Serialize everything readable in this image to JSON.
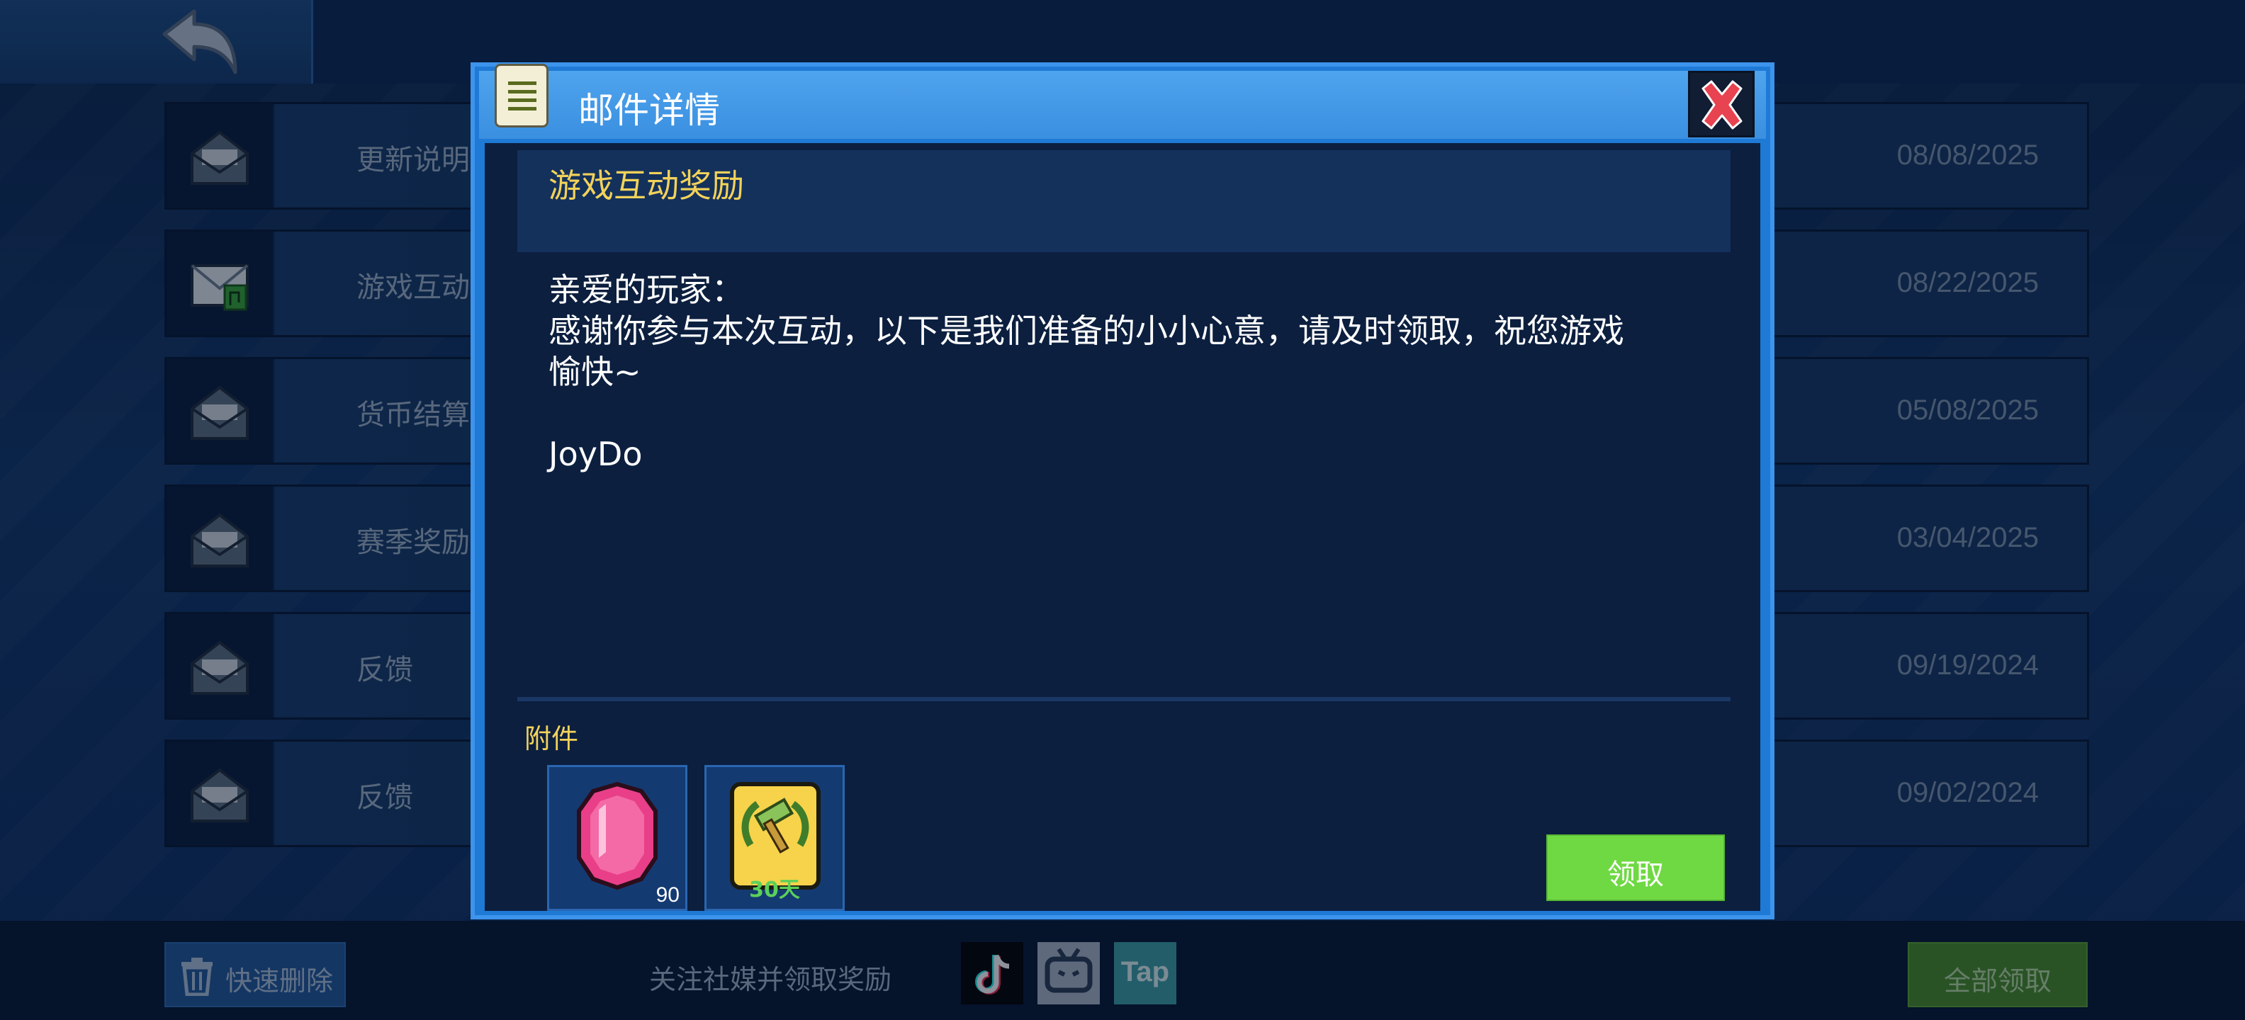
{
  "mail_list": [
    {
      "title": "更新说明",
      "date": "08/08/2025",
      "icon": "envelope-opened-icon"
    },
    {
      "title": "游戏互动",
      "date": "08/22/2025",
      "icon": "envelope-attachment-icon"
    },
    {
      "title": "货币结算",
      "date": "05/08/2025",
      "icon": "envelope-opened-icon"
    },
    {
      "title": "赛季奖励",
      "date": "03/04/2025",
      "icon": "envelope-opened-icon"
    },
    {
      "title": "反馈",
      "date": "09/19/2024",
      "icon": "envelope-opened-icon"
    },
    {
      "title": "反馈",
      "date": "09/02/2024",
      "icon": "envelope-opened-icon"
    }
  ],
  "dialog": {
    "title": "邮件详情",
    "subject": "游戏互动奖励",
    "message": "亲爱的玩家：\n感谢你参与本次互动，以下是我们准备的小小心意，请及时领取，祝您游戏\n愉快~\n\nJoyDo",
    "attachments_label": "附件",
    "attachments": [
      {
        "name": "pink-gem-icon",
        "quantity": "90"
      },
      {
        "name": "laurel-hammer-icon",
        "badge": "30天"
      }
    ],
    "claim_label": "领取"
  },
  "bottom": {
    "quick_delete_label": "快速删除",
    "social_text": "关注社媒并领取奖励",
    "tap_label": "Tap",
    "claim_all_label": "全部领取"
  },
  "colors": {
    "dialog_border": "#3d94ec",
    "subject": "#f3d25a",
    "claim_button": "#6fd944",
    "claim_all_button": "#4a8f2a"
  }
}
